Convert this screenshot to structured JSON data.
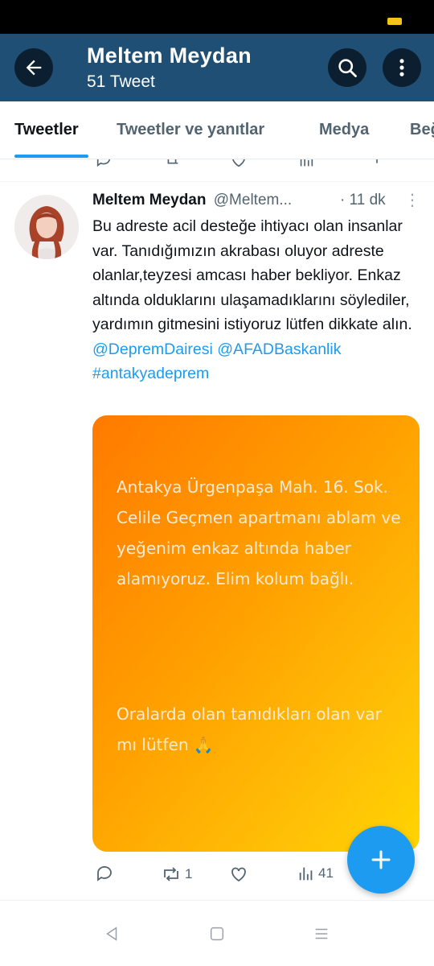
{
  "header": {
    "title": "Meltem Meydan",
    "subtitle": "51 Tweet",
    "back_icon": "arrow-left-icon",
    "search_icon": "search-icon",
    "more_icon": "more-vertical-icon"
  },
  "tabs": [
    {
      "label": "Tweetler",
      "active": true
    },
    {
      "label": "Tweetler ve yanıtlar",
      "active": false
    },
    {
      "label": "Medya",
      "active": false
    },
    {
      "label": "Beğeni",
      "active": false
    }
  ],
  "tweet": {
    "name": "Meltem Meydan",
    "handle": "@Meltem...",
    "time": "· 11 dk",
    "text": "Bu adreste acil desteğe ihtiyacı olan insanlar var. Tanıdığımızın akrabası oluyor adreste olanlar,teyzesi amcası haber bekliyor. Enkaz altında olduklarını ulaşamadıklarını söylediler, yardımın gitmesini istiyoruz lütfen dikkate alın.",
    "mention1": "@DepremDairesi",
    "mention2": "@AFADBaskanlik",
    "hashtag": "#antakyadeprem",
    "media_text_1": "Antakya Ürgenpaşa Mah. 16. Sok. Celile  Geçmen apartmanı ablam ve yeğenim enkaz altında haber alamıyoruz. Elim kolum bağlı.",
    "media_text_2": "Oralarda olan tanıdıkları  olan  var mı lütfen 🙏",
    "actions": {
      "reply_count": "",
      "retweet_count": "1",
      "like_count": "",
      "views_count": "41"
    }
  },
  "colors": {
    "header_bg": "#1f4f74",
    "accent": "#1d9bf0"
  }
}
